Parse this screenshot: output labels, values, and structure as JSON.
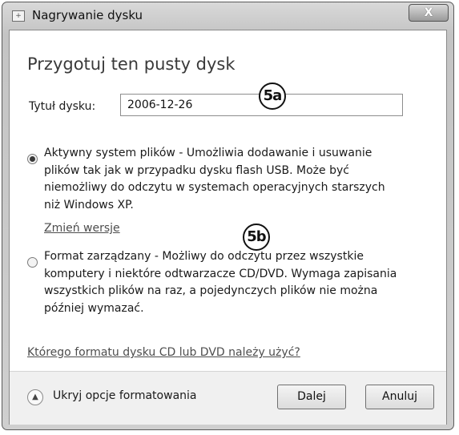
{
  "window": {
    "title": "Nagrywanie dysku",
    "close_glyph": "X",
    "icon": "burn-disc-icon"
  },
  "heading": "Przygotuj ten pusty dysk",
  "disc_title": {
    "label": "Tytuł dysku:",
    "value": "2006-12-26"
  },
  "options": [
    {
      "checked": true,
      "lines": [
        "Aktywny system plików - Umożliwia dodawanie i usuwanie",
        "plików tak jak w przypadku dysku flash USB. Może być",
        "niemożliwy do odczytu w systemach operacyjnych starszych",
        "niż Windows XP."
      ]
    },
    {
      "checked": false,
      "lines": [
        "Format zarządzany - Możliwy do odczytu przez wszystkie",
        "komputery i niektóre odtwarzacze CD/DVD. Wymaga zapisania",
        "wszystkich plików na raz, a pojedynczych plików nie można",
        "później wymazać."
      ]
    }
  ],
  "change_version_link": "Zmień wersje",
  "help_link": "Którego formatu dysku CD lub DVD należy użyć?",
  "footer": {
    "toggle_label": "Ukryj opcje formatowania",
    "toggle_icon": "chevron-up-icon",
    "next_button": "Dalej",
    "cancel_button": "Anuluj"
  },
  "annotations": {
    "a": "5a",
    "b": "5b"
  }
}
